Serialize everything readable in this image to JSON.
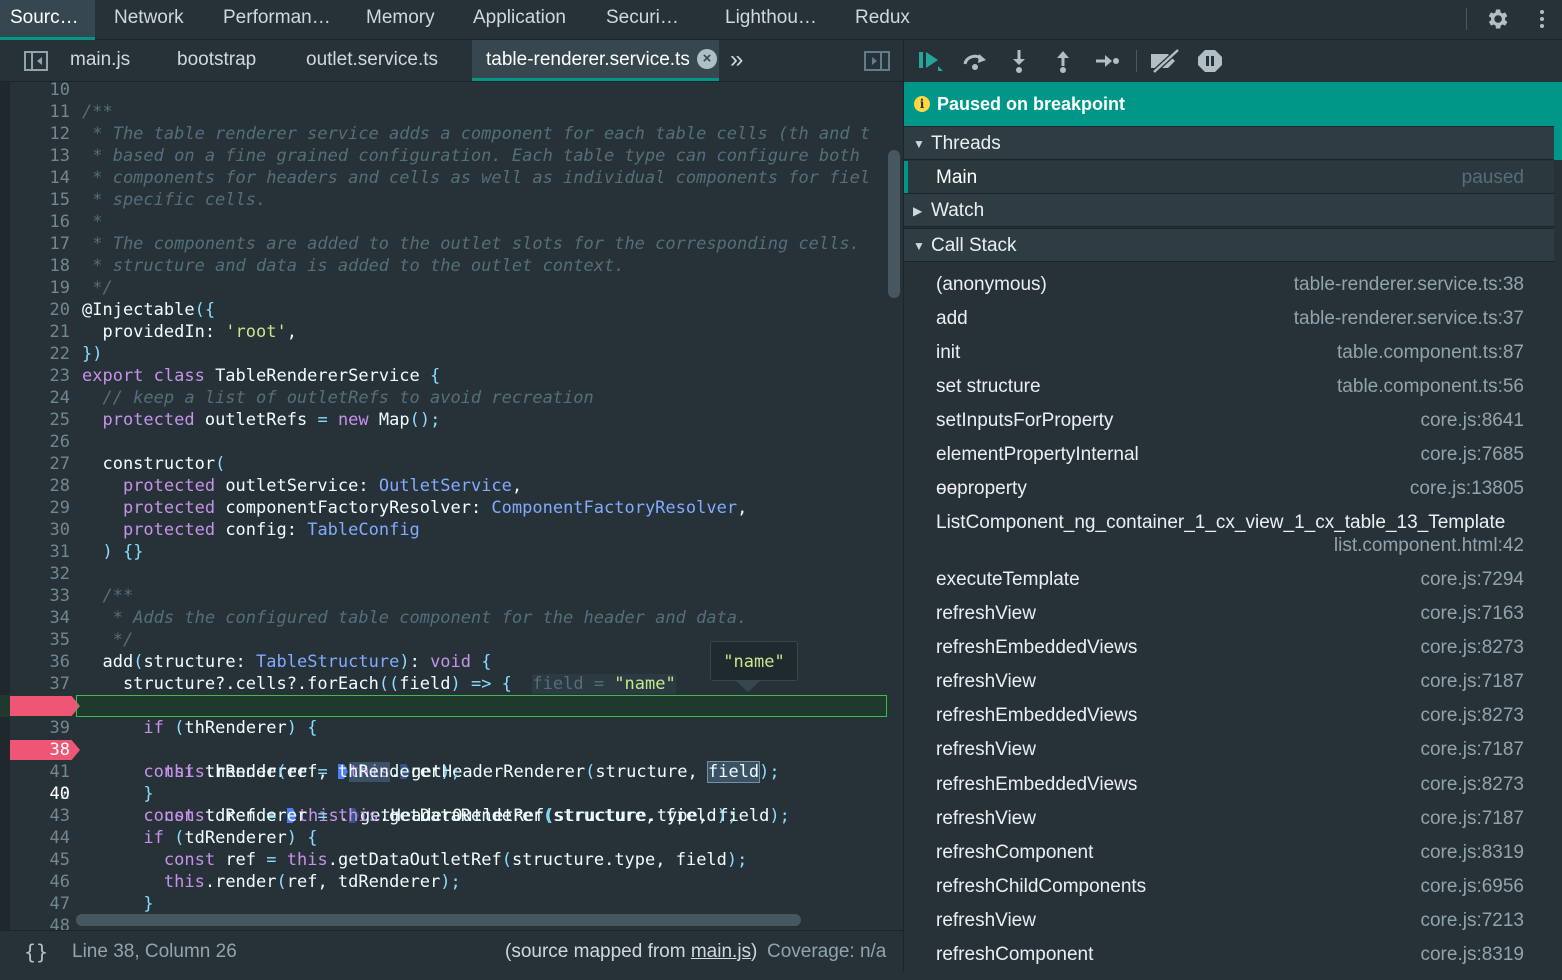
{
  "top_tabs": [
    "Sourc…",
    "Network",
    "Performan…",
    "Memory",
    "Application",
    "Securi…",
    "Lighthou…",
    "Redux"
  ],
  "editor_tabs": [
    "main.js",
    "bootstrap",
    "outlet.service.ts",
    "table-renderer.service.ts"
  ],
  "editor_tab_close": "×",
  "more_tabs": "»",
  "code": {
    "line_numbers": [
      "10",
      "11",
      "12",
      "13",
      "14",
      "15",
      "16",
      "17",
      "18",
      "19",
      "20",
      "21",
      "22",
      "23",
      "24",
      "25",
      "26",
      "27",
      "28",
      "29",
      "30",
      "31",
      "32",
      "33",
      "34",
      "35",
      "36",
      "37",
      "38",
      "39",
      "40",
      "41",
      "42",
      "43",
      "44",
      "45",
      "46",
      "47",
      "48"
    ],
    "lines": {
      "l11": "/**",
      "l12": " * The table renderer service adds a component for each table cells (th and t",
      "l13": " * based on a fine grained configuration. Each table type can configure both",
      "l14": " * components for headers and cells as well as individual components for fiel",
      "l15": " * specific cells.",
      "l16": " *",
      "l17": " * The components are added to the outlet slots for the corresponding cells.",
      "l18": " * structure and data is added to the outlet context.",
      "l19": " */",
      "l24": "  // keep a list of outletRefs to avoid recreation",
      "l33": "  /**",
      "l34": "   * Adds the configured table component for the header and data.",
      "l35": "   */"
    },
    "inline_value_label": "field",
    "inline_value_eq": " = ",
    "inline_value": "\"name\"",
    "tooltip": "\"name\""
  },
  "status": {
    "pretty_print": "{}",
    "cursor": "Line 38, Column 26",
    "source_mapped_prefix": "(source mapped from ",
    "source_mapped_link": "main.js",
    "source_mapped_suffix": ")",
    "coverage": "Coverage: n/a"
  },
  "debugger": {
    "paused_icon": "i",
    "paused_message": "Paused on breakpoint",
    "sections": {
      "threads": "Threads",
      "watch": "Watch",
      "call_stack": "Call Stack"
    },
    "thread": {
      "name": "Main",
      "state": "paused"
    },
    "call_stack": [
      {
        "fn": "(anonymous)",
        "loc": "table-renderer.service.ts:38"
      },
      {
        "fn": "add",
        "loc": "table-renderer.service.ts:37"
      },
      {
        "fn": "init",
        "loc": "table.component.ts:87"
      },
      {
        "fn": "set structure",
        "loc": "table.component.ts:56"
      },
      {
        "fn": "setInputsForProperty",
        "loc": "core.js:8641"
      },
      {
        "fn": "elementPropertyInternal",
        "loc": "core.js:7685"
      },
      {
        "fn": "ɵɵproperty",
        "loc": "core.js:13805"
      },
      {
        "fn": "ListComponent_ng_container_1_cx_view_1_cx_table_13_Template",
        "loc": "list.component.html:42"
      },
      {
        "fn": "executeTemplate",
        "loc": "core.js:7294"
      },
      {
        "fn": "refreshView",
        "loc": "core.js:7163"
      },
      {
        "fn": "refreshEmbeddedViews",
        "loc": "core.js:8273"
      },
      {
        "fn": "refreshView",
        "loc": "core.js:7187"
      },
      {
        "fn": "refreshEmbeddedViews",
        "loc": "core.js:8273"
      },
      {
        "fn": "refreshView",
        "loc": "core.js:7187"
      },
      {
        "fn": "refreshEmbeddedViews",
        "loc": "core.js:8273"
      },
      {
        "fn": "refreshView",
        "loc": "core.js:7187"
      },
      {
        "fn": "refreshComponent",
        "loc": "core.js:8319"
      },
      {
        "fn": "refreshChildComponents",
        "loc": "core.js:6956"
      },
      {
        "fn": "refreshView",
        "loc": "core.js:7213"
      },
      {
        "fn": "refreshComponent",
        "loc": "core.js:8319"
      }
    ]
  }
}
